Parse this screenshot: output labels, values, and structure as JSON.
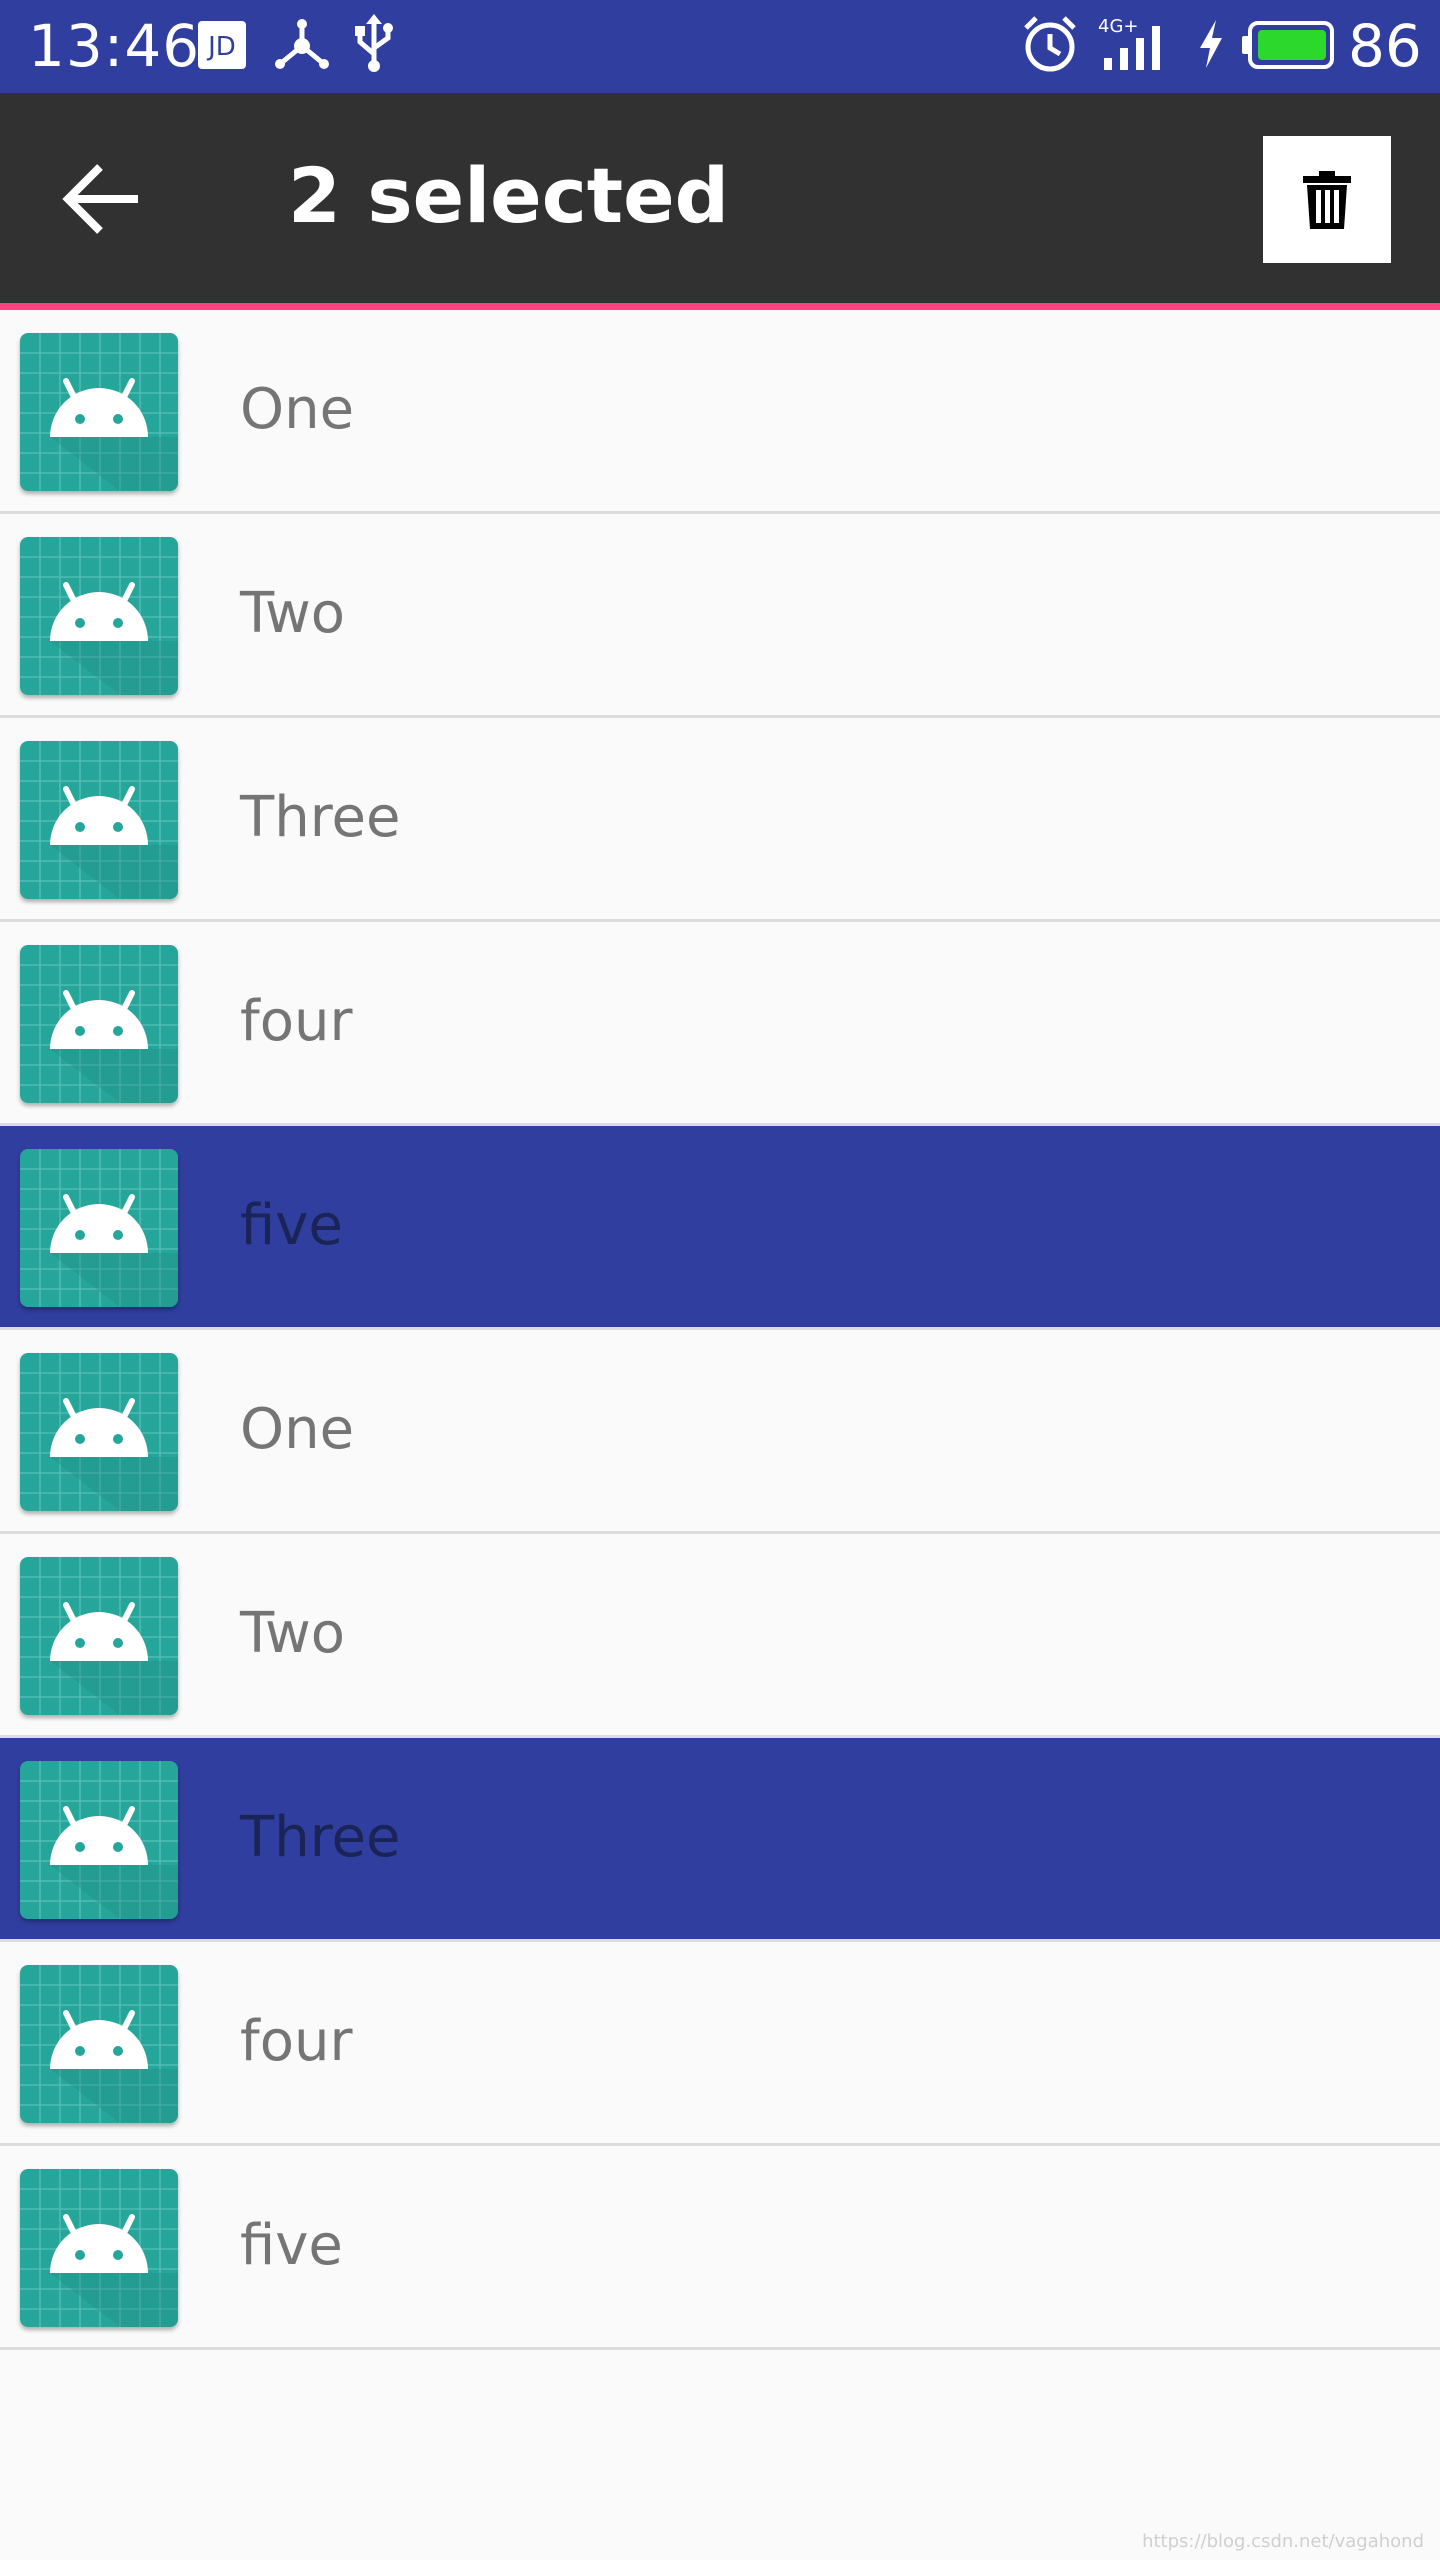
{
  "status_bar": {
    "time": "13:46",
    "battery_percent": "86",
    "network_label": "4G+",
    "icons": [
      "jd-icon",
      "share-icon",
      "usb-icon",
      "alarm-icon",
      "signal-icon",
      "charging-icon",
      "battery-icon"
    ],
    "background": "#303f9f"
  },
  "toolbar": {
    "title": "2 selected",
    "background": "#313131",
    "accent": "#ff4081",
    "back_icon": "back-arrow-icon",
    "delete_icon": "trash-icon"
  },
  "list": {
    "selected_color": "#303f9f",
    "items": [
      {
        "label": "One",
        "selected": false,
        "icon": "android-icon"
      },
      {
        "label": "Two",
        "selected": false,
        "icon": "android-icon"
      },
      {
        "label": "Three",
        "selected": false,
        "icon": "android-icon"
      },
      {
        "label": "four",
        "selected": false,
        "icon": "android-icon"
      },
      {
        "label": "five",
        "selected": true,
        "icon": "android-icon"
      },
      {
        "label": "One",
        "selected": false,
        "icon": "android-icon"
      },
      {
        "label": "Two",
        "selected": false,
        "icon": "android-icon"
      },
      {
        "label": "Three",
        "selected": true,
        "icon": "android-icon"
      },
      {
        "label": "four",
        "selected": false,
        "icon": "android-icon"
      },
      {
        "label": "five",
        "selected": false,
        "icon": "android-icon"
      }
    ]
  },
  "watermark": "https://blog.csdn.net/vagahond"
}
